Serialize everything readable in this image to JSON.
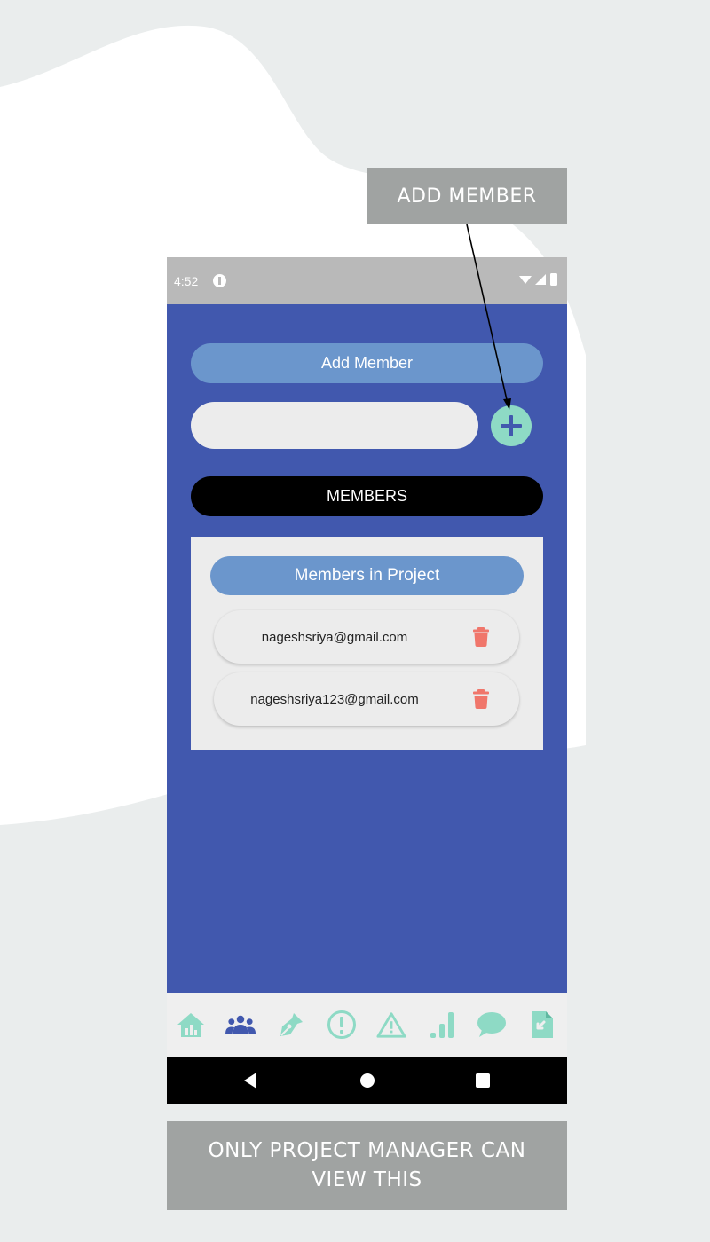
{
  "annotations": {
    "add_member_callout": "ADD MEMBER",
    "restriction_note": "ONLY PROJECT MANAGER CAN VIEW THIS"
  },
  "status_bar": {
    "time": "4:52"
  },
  "add_member": {
    "header_label": "Add Member",
    "input_value": "",
    "input_placeholder": ""
  },
  "members_button_label": "MEMBERS",
  "members_card": {
    "title": "Members in Project",
    "members": [
      {
        "email": "nageshsriya@gmail.com"
      },
      {
        "email": "nageshsriya123@gmail.com"
      }
    ]
  },
  "bottom_nav": {
    "items": [
      {
        "icon": "home-chart-icon",
        "active": false
      },
      {
        "icon": "members-icon",
        "active": true
      },
      {
        "icon": "pen-icon",
        "active": false
      },
      {
        "icon": "alert-circle-icon",
        "active": false
      },
      {
        "icon": "warning-icon",
        "active": false
      },
      {
        "icon": "bar-chart-icon",
        "active": false
      },
      {
        "icon": "chat-icon",
        "active": false
      },
      {
        "icon": "file-import-icon",
        "active": false
      }
    ]
  },
  "colors": {
    "primary": "#4158ae",
    "pill": "#6b96cc",
    "accent": "#8edac5",
    "delete": "#f0766b",
    "nav_active": "#4158ae"
  }
}
